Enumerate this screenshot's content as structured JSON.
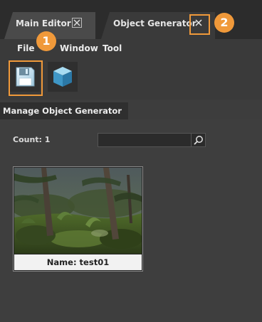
{
  "tabs": [
    {
      "label": "Main Editor",
      "close_icon": "close-icon"
    },
    {
      "label": "Object Generator",
      "close_icon": "close-icon",
      "active": true
    }
  ],
  "menu": [
    "File",
    "Window",
    "Tool"
  ],
  "toolbar": {
    "save_icon": "save-floppy-icon",
    "cube_icon": "cube-icon"
  },
  "panel": {
    "title": "Manage Object Generator",
    "count_label": "Count: 1",
    "search_value": "",
    "search_icon": "search-icon"
  },
  "items": [
    {
      "caption": "Name: test01",
      "thumbnail": "forest-scene-thumbnail"
    }
  ],
  "callouts": [
    "1",
    "2"
  ],
  "colors": {
    "accent": "#f0993a",
    "background": "#3d3d3d",
    "tabbar": "#2c2c2c"
  }
}
